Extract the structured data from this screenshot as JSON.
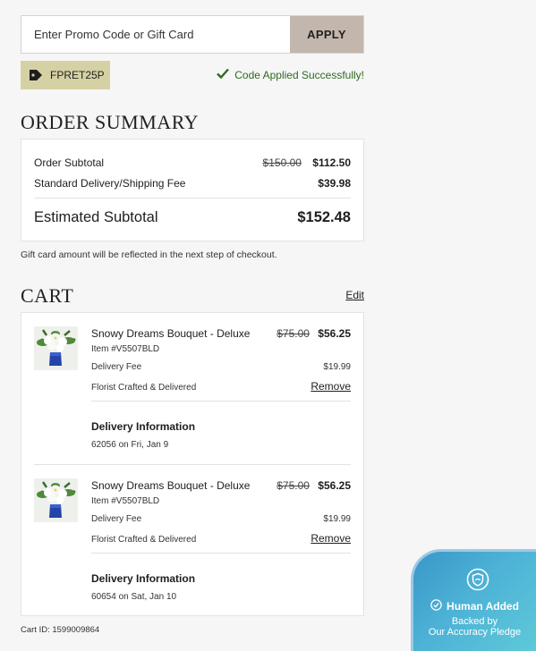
{
  "promo": {
    "placeholder": "Enter Promo Code or Gift Card",
    "apply_label": "APPLY",
    "applied_code": "FPRET25P",
    "success_message": "Code Applied Successfully!"
  },
  "order_summary": {
    "title": "ORDER SUMMARY",
    "subtotal_label": "Order Subtotal",
    "subtotal_original": "$150.00",
    "subtotal_value": "$112.50",
    "delivery_label": "Standard Delivery/Shipping Fee",
    "delivery_value": "$39.98",
    "estimated_label": "Estimated Subtotal",
    "estimated_value": "$152.48"
  },
  "gift_note": "Gift card amount will be reflected in the next step of checkout.",
  "cart": {
    "title": "CART",
    "edit_label": "Edit",
    "items": [
      {
        "name": "Snowy Dreams Bouquet - Deluxe",
        "original_price": "$75.00",
        "price": "$56.25",
        "sku": "Item #V5507BLD",
        "fee_label": "Delivery Fee",
        "fee_value": "$19.99",
        "crafted": "Florist Crafted & Delivered",
        "remove_label": "Remove",
        "delivery_title": "Delivery Information",
        "delivery_detail": "62056 on Fri, Jan 9"
      },
      {
        "name": "Snowy Dreams Bouquet - Deluxe",
        "original_price": "$75.00",
        "price": "$56.25",
        "sku": "Item #V5507BLD",
        "fee_label": "Delivery Fee",
        "fee_value": "$19.99",
        "crafted": "Florist Crafted & Delivered",
        "remove_label": "Remove",
        "delivery_title": "Delivery Information",
        "delivery_detail": "60654 on Sat, Jan 10"
      }
    ]
  },
  "cart_id": "Cart ID: 1599009864",
  "badge": {
    "added": "Human Added",
    "backed": "Backed by",
    "pledge": "Our Accuracy Pledge"
  },
  "colors": {
    "apply_bg": "#c2b6ad",
    "tag_bg": "#d5d1a4",
    "success": "#2f6a21",
    "badge_blue": "#3a96c8",
    "badge_teal": "#5ec9d9"
  },
  "icons": [
    "tag-icon",
    "check-icon",
    "shield-icon",
    "check-circle-icon",
    "bouquet-thumbnail"
  ]
}
